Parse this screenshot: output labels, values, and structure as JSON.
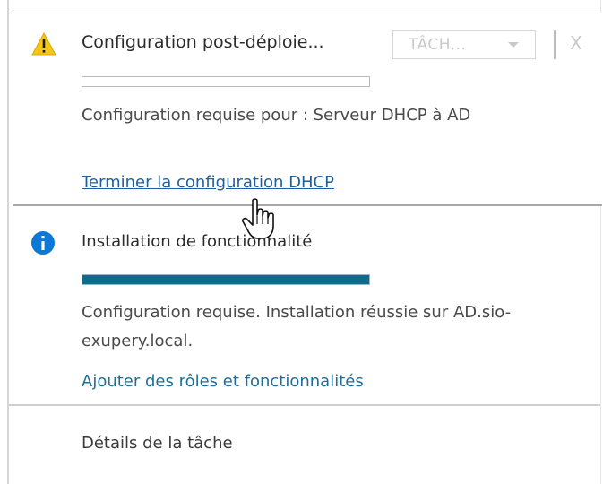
{
  "notifications": [
    {
      "icon": "warning-icon",
      "title": "Configuration post-déploie...",
      "task_dropdown": "TÂCH...",
      "close_label": "X",
      "progress": 0,
      "description": "Configuration requise pour : Serveur DHCP à AD",
      "link": "Terminer la configuration DHCP"
    },
    {
      "icon": "info-icon",
      "title": "Installation de fonctionnalité",
      "progress": 1,
      "description_line1": "Configuration requise. Installation réussie sur AD.sio-",
      "description_line2": "exupery.local.",
      "link": "Ajouter des rôles et fonctionnalités"
    }
  ],
  "footer": {
    "details_link": "Détails de la tâche"
  },
  "colors": {
    "warning": "#f5c518",
    "info": "#0a78d7",
    "progress_fill": "#0f6c8e",
    "link": "#1f5f9e"
  }
}
